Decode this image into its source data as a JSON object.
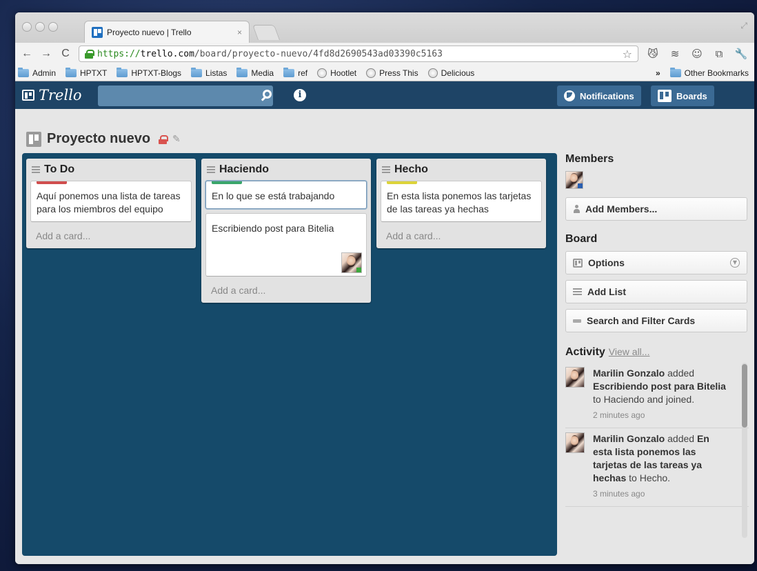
{
  "browser": {
    "tab_title": "Proyecto nuevo | Trello",
    "tab_close": "×",
    "url_scheme": "https://",
    "url_host": "trello.com",
    "url_path": "/board/proyecto-nuevo/4fd8d2690543ad03390c5163",
    "nav": {
      "back": "←",
      "forward": "→",
      "reload": "C"
    },
    "star": "☆",
    "extensions": [
      "😼",
      "≋",
      "☺",
      "⧉",
      "🔧"
    ]
  },
  "bookmarks": {
    "items": [
      {
        "label": "Admin",
        "icon": "folder-icon"
      },
      {
        "label": "HPTXT",
        "icon": "folder-icon"
      },
      {
        "label": "HPTXT-Blogs",
        "icon": "folder-icon"
      },
      {
        "label": "Listas",
        "icon": "folder-icon"
      },
      {
        "label": "Media",
        "icon": "folder-icon"
      },
      {
        "label": "ref",
        "icon": "folder-icon"
      },
      {
        "label": "Hootlet",
        "icon": "globe-icon"
      },
      {
        "label": "Press This",
        "icon": "globe-icon"
      },
      {
        "label": "Delicious",
        "icon": "globe-icon"
      }
    ],
    "overflow": "»",
    "other": "Other Bookmarks"
  },
  "trello": {
    "logo": "Trello",
    "notifications_label": "Notifications",
    "boards_label": "Boards",
    "info": "i"
  },
  "board": {
    "title": "Proyecto nuevo",
    "pencil": "✎",
    "lists": [
      {
        "name": "To Do",
        "label_color": "#d04e4e",
        "cards": [
          {
            "text": "Aquí ponemos una lista de tareas para los miembros del equipo"
          }
        ],
        "add_card": "Add a card..."
      },
      {
        "name": "Haciendo",
        "label_color": "#3aa66b",
        "cards": [
          {
            "text": "En lo que se está trabajando"
          },
          {
            "text": "Escribiendo post para Bitelia"
          }
        ],
        "add_card": "Add a card..."
      },
      {
        "name": "Hecho",
        "label_color": "#dcd33a",
        "cards": [
          {
            "text": "En esta lista ponemos las tarjetas de las tareas ya hechas"
          }
        ],
        "add_card": "Add a card..."
      }
    ]
  },
  "sidebar": {
    "members_heading": "Members",
    "add_members": "Add Members...",
    "board_heading": "Board",
    "options": "Options",
    "add_list": "Add List",
    "search_filter": "Search and Filter Cards",
    "activity_heading": "Activity",
    "view_all": "View all...",
    "activity": [
      {
        "user": "Marilin Gonzalo",
        "action": " added ",
        "card": "Escribiendo post para Bitelia",
        "rest": " to Haciendo and joined.",
        "time": "2 minutes ago"
      },
      {
        "user": "Marilin Gonzalo",
        "action": " added ",
        "card": "En esta lista ponemos las tarjetas de las tareas ya hechas",
        "rest": " to Hecho.",
        "time": "3 minutes ago"
      }
    ]
  }
}
